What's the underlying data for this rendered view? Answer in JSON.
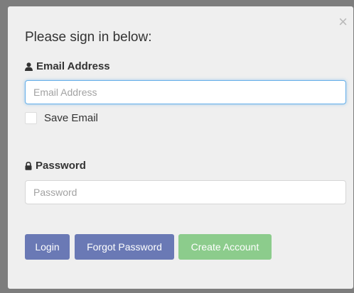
{
  "dialog": {
    "close_glyph": "×",
    "heading": "Please sign in below:",
    "email": {
      "label": "Email Address",
      "icon": "user-icon",
      "placeholder": "Email Address",
      "value": ""
    },
    "save_email": {
      "label": "Save Email",
      "checked": false
    },
    "password": {
      "label": "Password",
      "icon": "lock-icon",
      "placeholder": "Password",
      "value": ""
    },
    "buttons": {
      "login": "Login",
      "forgot_password": "Forgot Password",
      "create_account": "Create Account"
    },
    "colors": {
      "primary_button": "#6a79b5",
      "success_button": "#8ccc8c",
      "focus_border": "#66afe9"
    }
  }
}
